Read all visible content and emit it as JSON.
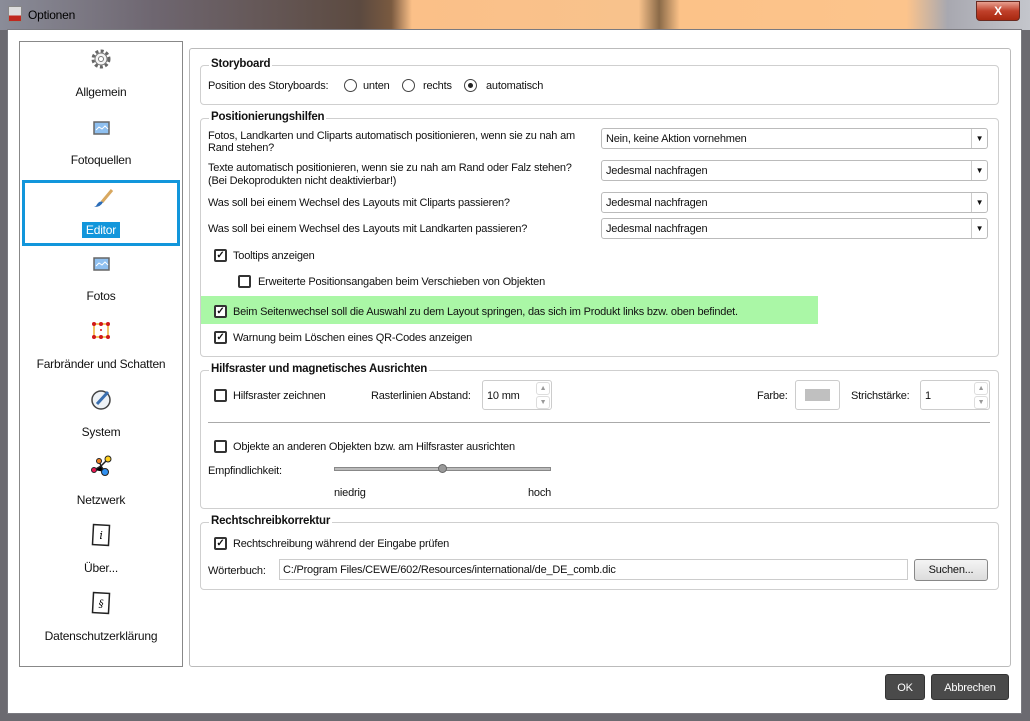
{
  "window": {
    "title": "Optionen",
    "close_label": "X"
  },
  "sidebar": {
    "items": [
      {
        "label": "Allgemein",
        "icon": "gear-icon"
      },
      {
        "label": "Fotoquellen",
        "icon": "image-icon"
      },
      {
        "label": "Editor",
        "icon": "brush-icon",
        "selected": true
      },
      {
        "label": "Fotos",
        "icon": "image-icon"
      },
      {
        "label": "Farbränder und Schatten",
        "icon": "frame-icon"
      },
      {
        "label": "System",
        "icon": "system-icon"
      },
      {
        "label": "Netzwerk",
        "icon": "network-icon"
      },
      {
        "label": "Über...",
        "icon": "info-icon"
      },
      {
        "label": "Datenschutzerklärung",
        "icon": "paragraph-icon"
      }
    ]
  },
  "storyboard": {
    "title": "Storyboard",
    "label": "Position des Storyboards:",
    "options": [
      "unten",
      "rechts",
      "automatisch"
    ],
    "selected": "automatisch"
  },
  "positioning": {
    "title": "Positionierungshilfen",
    "rows": [
      {
        "label1": "Fotos, Landkarten und Cliparts automatisch positionieren, wenn sie zu nah am",
        "label2": "Rand stehen?",
        "value": "Nein, keine Aktion vornehmen"
      },
      {
        "label1": "Texte automatisch positionieren, wenn sie zu nah am Rand oder Falz stehen?",
        "label2": "(Bei Dekoprodukten nicht deaktivierbar!)",
        "value": "Jedesmal nachfragen"
      },
      {
        "label1": "Was soll bei einem Wechsel des Layouts mit Cliparts passieren?",
        "value": "Jedesmal nachfragen"
      },
      {
        "label1": "Was soll bei einem Wechsel des Layouts mit Landkarten passieren?",
        "value": "Jedesmal nachfragen"
      }
    ],
    "checks": [
      {
        "label": "Tooltips anzeigen",
        "checked": true
      },
      {
        "label": "Erweiterte Positionsangaben beim Verschieben von Objekten",
        "checked": false
      },
      {
        "label": "Beim Seitenwechsel soll die Auswahl zu dem Layout springen, das sich im Produkt links bzw. oben befindet.",
        "checked": true
      },
      {
        "label": "Warnung beim Löschen eines QR-Codes anzeigen",
        "checked": true
      }
    ],
    "highlight_color": "#aaf7a6"
  },
  "grid": {
    "title": "Hilfsraster und magnetisches Ausrichten",
    "draw_label": "Hilfsraster zeichnen",
    "spacing_label": "Rasterlinien Abstand:",
    "spacing_value": "10 mm",
    "color_label": "Farbe:",
    "color_value": "#c0c0c0",
    "stroke_label": "Strichstärke:",
    "stroke_value": "1",
    "snap_label": "Objekte an anderen Objekten bzw. am Hilfsraster ausrichten",
    "sensitivity_label": "Empfindlichkeit:",
    "low": "niedrig",
    "high": "hoch",
    "sensitivity": 0.5
  },
  "spell": {
    "title": "Rechtschreibkorrektur",
    "check_label": "Rechtschreibung während der Eingabe prüfen",
    "dict_label": "Wörterbuch:",
    "dict_value": "C:/Program Files/CEWE/602/Resources/international/de_DE_comb.dic",
    "browse": "Suchen..."
  },
  "footer": {
    "ok": "OK",
    "cancel": "Abbrechen"
  },
  "check_mark": "✓"
}
